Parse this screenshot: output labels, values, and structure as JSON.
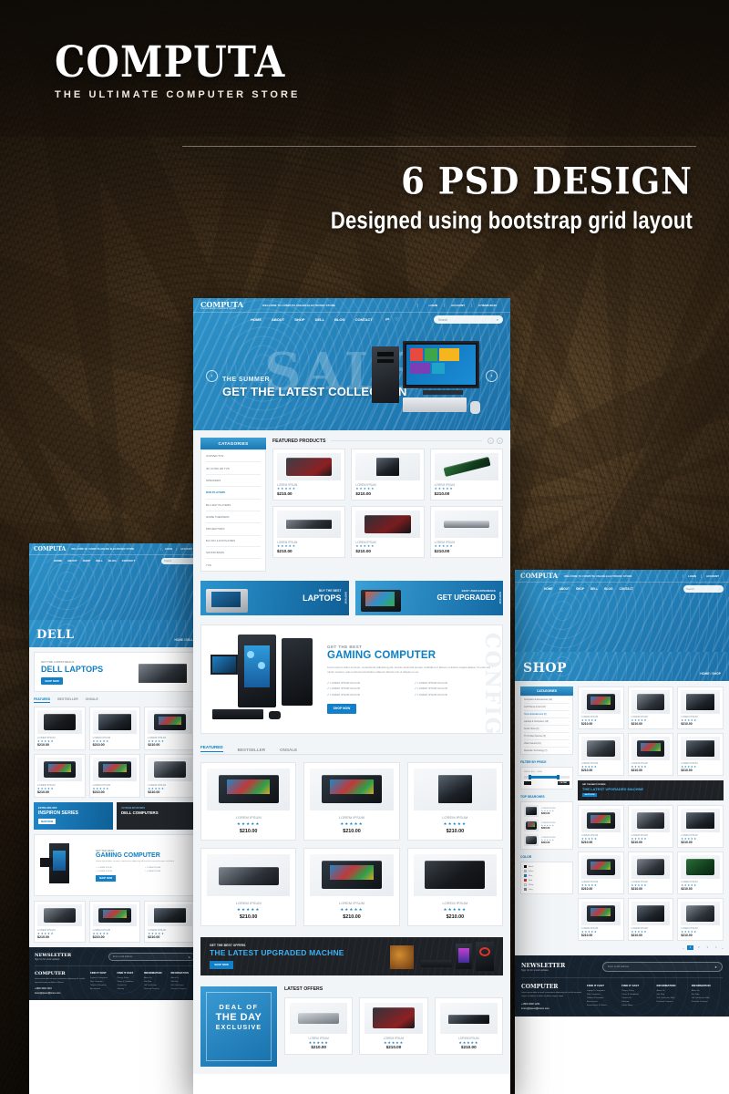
{
  "page": {
    "background_color": "#2e2113",
    "accent_color": "#1280c8",
    "dark_color": "#16222e"
  },
  "header": {
    "logo": "COMPUTA",
    "tagline": "THE ULTIMATE COMPUTER STORE"
  },
  "promo": {
    "title": "6 PSD DESIGN",
    "subtitle": "Designed using bootstrap grid layout"
  },
  "site": {
    "logo": "COMPUTA",
    "logo_sub": "THE ULTIMATE COMPUTER STORE",
    "welcome": "WELCOME TO COMPUTA ONLINE ELECTRONIC STORE",
    "topbar": [
      {
        "icon": "user-icon",
        "label": "LOGIN"
      },
      {
        "icon": "account-icon",
        "label": "ACCOUNT"
      },
      {
        "icon": "cart-icon",
        "label": "0 ITEMS $0.00"
      }
    ],
    "nav": [
      "HOME",
      "ABOUT",
      "SHOP",
      "DELL",
      "BLOG",
      "CONTACT"
    ],
    "nav_icons": [
      "compare-icon",
      "wishlist-icon"
    ],
    "search_placeholder": "Search",
    "search_icon": "search-icon"
  },
  "hero": {
    "eyebrow": "THE SUMMER",
    "title": "GET THE LATEST COLLECTION",
    "watermark": "SALE",
    "prev_icon": "chevron-left-icon",
    "next_icon": "chevron-right-icon"
  },
  "categories": {
    "title": "CATAGORIES",
    "items": [
      "CURVED TVS",
      "4K ULTRA HD TVS",
      "SPEAKERS",
      "DVD PLAYERS",
      "BLU-RAY PLAYERS",
      "HOME THEATERS",
      "PROJECTORS",
      "BLU-RAY & DVD PLAYERS",
      "SOUND BARS",
      "TVS"
    ],
    "active_index": 3
  },
  "featured_products": {
    "title": "FEATURED PRODUCTS",
    "prev_icon": "arrow-left-icon",
    "next_icon": "arrow-right-icon",
    "items": [
      {
        "name": "LOREM IPSUM",
        "price": "$210.00",
        "rating": 5
      },
      {
        "name": "LOREM IPSUM",
        "price": "$210.00",
        "rating": 5
      },
      {
        "name": "LOREM IPSUM",
        "price": "$210.00",
        "rating": 5
      },
      {
        "name": "LOREM IPSUM",
        "price": "$210.00",
        "rating": 5
      },
      {
        "name": "LOREM IPSUM",
        "price": "$210.00",
        "rating": 5
      },
      {
        "name": "LOREM IPSUM",
        "price": "$210.00",
        "rating": 5
      }
    ]
  },
  "banners": [
    {
      "eyebrow": "BUY THE BEST",
      "title": "LAPTOPS",
      "cta": "SHOP NOW"
    },
    {
      "eyebrow": "BEST USER EXPERIENCE",
      "title": "GET UPGRADED",
      "cta": "SHOP NOW"
    }
  ],
  "gaming": {
    "eyebrow": "GET THE BEST",
    "title": "GAMING COMPUTER",
    "body": "Lorem ipsum dolor sit amet, consectetur adipiscing elit, sed do eiusmod tempor incididunt ut labore et dolore magna aliqua. Ut enim ad minim veniam, quis nostrud exercitation ullamco laboris nisi ut aliquip ex ea.",
    "features": [
      "LOREM IPSUM DOLOR",
      "LOREM IPSUM DOLOR",
      "LOREM IPSUM DOLOR",
      "LOREM IPSUM DOLOR",
      "LOREM IPSUM DOLOR",
      "LOREM IPSUM DOLOR"
    ],
    "cta": "SHOP NOW",
    "watermark": "CONFIGURE",
    "check_icon": "check-icon"
  },
  "product_tabs": {
    "tabs": [
      "FEATURED",
      "BESTSELLER",
      "ONSALE"
    ],
    "active": "FEATURED",
    "items": [
      {
        "name": "LOREM IPSUM",
        "price": "$210.00",
        "rating": 5
      },
      {
        "name": "LOREM IPSUM",
        "price": "$210.00",
        "rating": 5
      },
      {
        "name": "LOREM IPSUM",
        "price": "$210.00",
        "rating": 5
      },
      {
        "name": "LOREM IPSUM",
        "price": "$210.00",
        "rating": 5
      },
      {
        "name": "LOREM IPSUM",
        "price": "$210.00",
        "rating": 5
      },
      {
        "name": "LOREM IPSUM",
        "price": "$210.00",
        "rating": 5
      }
    ]
  },
  "offers_banner": {
    "eyebrow": "GET THE BEST OFFERS",
    "title": "THE LATEST UPGRADED MACHNE",
    "cta": "SHOP NOW"
  },
  "deal": {
    "line1": "DEAL OF",
    "line2": "THE DAY",
    "line3": "EXCLUSIVE"
  },
  "latest_offers": {
    "title": "LATEST OFFERS",
    "items": [
      {
        "name": "LOREM IPSUM",
        "price": "$210.00",
        "rating": 5
      },
      {
        "name": "LOREM IPSUM",
        "price": "$210.00",
        "rating": 5
      },
      {
        "name": "LOREM IPSUM",
        "price": "$210.00",
        "rating": 5
      }
    ]
  },
  "dell_page": {
    "page_title": "DELL",
    "breadcrumb": "HOME / DELL",
    "hero": {
      "eyebrow": "GET THE LATEST DEALS",
      "title": "DELL LAPTOPS",
      "cta": "SHOP NOW"
    },
    "tabs": [
      "FEATURED",
      "BESTSELLER",
      "ONSALE"
    ],
    "active_tab": "FEATURED",
    "items": [
      {
        "name": "LOREM IPSUM",
        "price": "$210.00",
        "rating": 5
      },
      {
        "name": "LOREM IPSUM",
        "price": "$210.00",
        "rating": 5
      },
      {
        "name": "LOREM IPSUM",
        "price": "$210.00",
        "rating": 5
      },
      {
        "name": "LOREM IPSUM",
        "price": "$210.00",
        "rating": 5
      },
      {
        "name": "LOREM IPSUM",
        "price": "$210.00",
        "rating": 5
      },
      {
        "name": "LOREM IPSUM",
        "price": "$210.00",
        "rating": 5
      }
    ],
    "promo_left": {
      "eyebrow": "EXTRA 30% OFF",
      "title": "INSPIRON SERIES",
      "cta": "SHOP NOW"
    },
    "promo_right": {
      "eyebrow": "ULTRASLIM OFFERS",
      "title": "DELL COMPUTERS"
    },
    "gaming": {
      "eyebrow": "GET THE BEST",
      "title": "GAMING COMPUTER",
      "cta": "SHOP NOW"
    },
    "bottom_items": [
      {
        "name": "LOREM IPSUM",
        "price": "$210.00",
        "rating": 5
      },
      {
        "name": "LOREM IPSUM",
        "price": "$210.00",
        "rating": 5
      },
      {
        "name": "LOREM IPSUM",
        "price": "$210.00",
        "rating": 5
      }
    ]
  },
  "shop_page": {
    "page_title": "SHOP",
    "breadcrumb": "HOME / SHOP",
    "categories_title": "CATAGORIES",
    "categories": [
      "Computers & Accessories (12)",
      "Cell Phones & Accessories (23)",
      "Home Entertainment (8)",
      "Laptops & Computers (15)",
      "Smart Home (9)",
      "TV & Video Devices (5)",
      "Video Games (14)",
      "Wearable Technology (7)"
    ],
    "filter_title": "FILTER BY PRICE",
    "filter_range": "PRICE: $20 — $300",
    "filter_button": "FILTER",
    "top_searches_title": "TOP SEARCHES",
    "color_title": "COLOR",
    "colors": [
      "Black",
      "Silver",
      "Blue",
      "Red",
      "White",
      "Grey"
    ],
    "items": [
      {
        "name": "LOREM IPSUM",
        "price": "$210.00",
        "rating": 5
      },
      {
        "name": "LOREM IPSUM",
        "price": "$210.00",
        "rating": 5
      },
      {
        "name": "LOREM IPSUM",
        "price": "$210.00",
        "rating": 5
      },
      {
        "name": "LOREM IPSUM",
        "price": "$210.00",
        "rating": 5
      },
      {
        "name": "LOREM IPSUM",
        "price": "$210.00",
        "rating": 5
      },
      {
        "name": "LOREM IPSUM",
        "price": "$210.00",
        "rating": 5
      },
      {
        "name": "LOREM IPSUM",
        "price": "$210.00",
        "rating": 5
      },
      {
        "name": "LOREM IPSUM",
        "price": "$210.00",
        "rating": 5
      },
      {
        "name": "LOREM IPSUM",
        "price": "$210.00",
        "rating": 5
      },
      {
        "name": "LOREM IPSUM",
        "price": "$210.00",
        "rating": 5
      },
      {
        "name": "LOREM IPSUM",
        "price": "$210.00",
        "rating": 5
      },
      {
        "name": "LOREM IPSUM",
        "price": "$210.00",
        "rating": 5
      },
      {
        "name": "LOREM IPSUM",
        "price": "$210.00",
        "rating": 5
      },
      {
        "name": "LOREM IPSUM",
        "price": "$210.00",
        "rating": 5
      },
      {
        "name": "LOREM IPSUM",
        "price": "$210.00",
        "rating": 5
      }
    ],
    "mid_banner": {
      "eyebrow": "GET THE BEST OFFERS",
      "title": "THE LATEST UPGRADED MACHNE",
      "cta": "SHOP NOW"
    },
    "pagination": [
      "1",
      "2",
      "3",
      "4"
    ],
    "pagination_active": "1",
    "pagination_prev_icon": "chevron-left-icon",
    "pagination_next_icon": "chevron-right-icon"
  },
  "footer": {
    "newsletter_title": "NEWSLETTER",
    "newsletter_sub": "Sign Up for email updates",
    "email_placeholder": "Enter email address",
    "submit_icon": "send-icon",
    "brand": "COMPUTER",
    "about": "Lorem ipsum dolor sit amet, consectetur adipiscing elit, sed do eiusmod tempor incididunt ut labore et dolore magna aliqua. Ut enim ad minim veniam, quis nostrud exercitation ullamco laboris nisi ut aliquip ex ea commodo.",
    "phone": "+1800 3000 1234",
    "phone_icon": "phone-icon",
    "email": "lorem@ipsum@lorem.com",
    "email_icon": "mail-icon",
    "columns": [
      {
        "title": "FIND IT FAST",
        "links": [
          "Laptop & Computers",
          "New Computer",
          "Tablets & Ereaders",
          "Accessories",
          "Smart Home & Tablets"
        ]
      },
      {
        "title": "FIND IT FAST",
        "links": [
          "Privacy Policy",
          "Terms & Conditions",
          "Contact Us",
          "Sitemap",
          "Latest News"
        ]
      },
      {
        "title": "INFORMATION",
        "links": [
          "About Us",
          "Site Map",
          "Gift Certificates FAQ",
          "Discount Coupons"
        ]
      },
      {
        "title": "INFORMATION",
        "links": [
          "About Us",
          "Site Map",
          "Gift Certificates FAQ",
          "Discount Coupons"
        ]
      }
    ]
  }
}
